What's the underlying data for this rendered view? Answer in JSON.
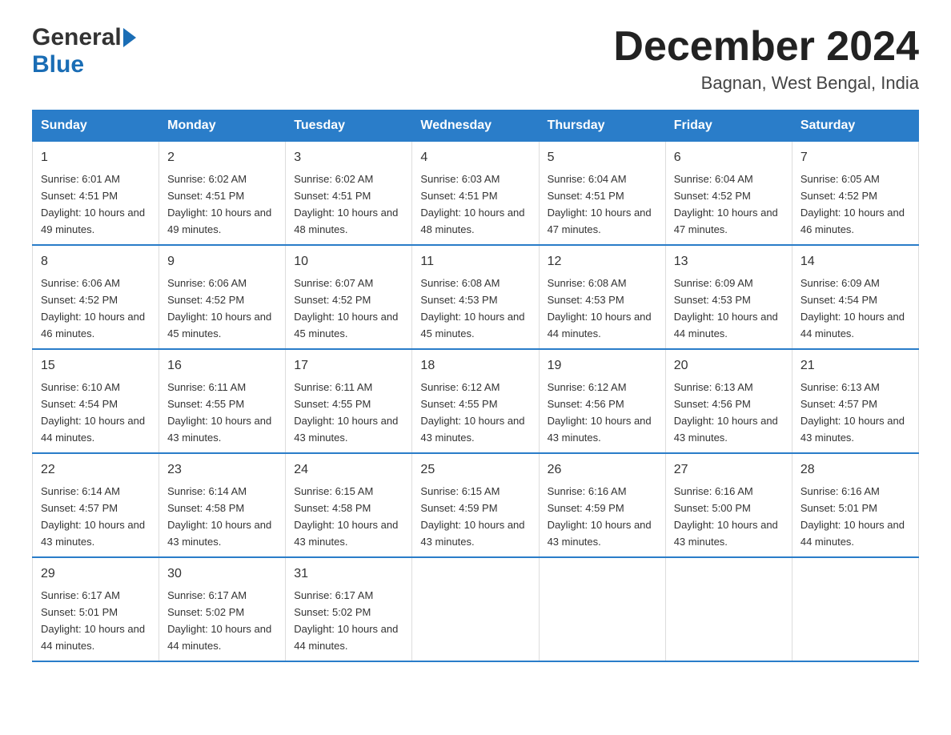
{
  "logo": {
    "general": "General",
    "blue": "Blue"
  },
  "title": "December 2024",
  "subtitle": "Bagnan, West Bengal, India",
  "days": [
    "Sunday",
    "Monday",
    "Tuesday",
    "Wednesday",
    "Thursday",
    "Friday",
    "Saturday"
  ],
  "weeks": [
    [
      {
        "num": "1",
        "sunrise": "6:01 AM",
        "sunset": "4:51 PM",
        "daylight": "10 hours and 49 minutes."
      },
      {
        "num": "2",
        "sunrise": "6:02 AM",
        "sunset": "4:51 PM",
        "daylight": "10 hours and 49 minutes."
      },
      {
        "num": "3",
        "sunrise": "6:02 AM",
        "sunset": "4:51 PM",
        "daylight": "10 hours and 48 minutes."
      },
      {
        "num": "4",
        "sunrise": "6:03 AM",
        "sunset": "4:51 PM",
        "daylight": "10 hours and 48 minutes."
      },
      {
        "num": "5",
        "sunrise": "6:04 AM",
        "sunset": "4:51 PM",
        "daylight": "10 hours and 47 minutes."
      },
      {
        "num": "6",
        "sunrise": "6:04 AM",
        "sunset": "4:52 PM",
        "daylight": "10 hours and 47 minutes."
      },
      {
        "num": "7",
        "sunrise": "6:05 AM",
        "sunset": "4:52 PM",
        "daylight": "10 hours and 46 minutes."
      }
    ],
    [
      {
        "num": "8",
        "sunrise": "6:06 AM",
        "sunset": "4:52 PM",
        "daylight": "10 hours and 46 minutes."
      },
      {
        "num": "9",
        "sunrise": "6:06 AM",
        "sunset": "4:52 PM",
        "daylight": "10 hours and 45 minutes."
      },
      {
        "num": "10",
        "sunrise": "6:07 AM",
        "sunset": "4:52 PM",
        "daylight": "10 hours and 45 minutes."
      },
      {
        "num": "11",
        "sunrise": "6:08 AM",
        "sunset": "4:53 PM",
        "daylight": "10 hours and 45 minutes."
      },
      {
        "num": "12",
        "sunrise": "6:08 AM",
        "sunset": "4:53 PM",
        "daylight": "10 hours and 44 minutes."
      },
      {
        "num": "13",
        "sunrise": "6:09 AM",
        "sunset": "4:53 PM",
        "daylight": "10 hours and 44 minutes."
      },
      {
        "num": "14",
        "sunrise": "6:09 AM",
        "sunset": "4:54 PM",
        "daylight": "10 hours and 44 minutes."
      }
    ],
    [
      {
        "num": "15",
        "sunrise": "6:10 AM",
        "sunset": "4:54 PM",
        "daylight": "10 hours and 44 minutes."
      },
      {
        "num": "16",
        "sunrise": "6:11 AM",
        "sunset": "4:55 PM",
        "daylight": "10 hours and 43 minutes."
      },
      {
        "num": "17",
        "sunrise": "6:11 AM",
        "sunset": "4:55 PM",
        "daylight": "10 hours and 43 minutes."
      },
      {
        "num": "18",
        "sunrise": "6:12 AM",
        "sunset": "4:55 PM",
        "daylight": "10 hours and 43 minutes."
      },
      {
        "num": "19",
        "sunrise": "6:12 AM",
        "sunset": "4:56 PM",
        "daylight": "10 hours and 43 minutes."
      },
      {
        "num": "20",
        "sunrise": "6:13 AM",
        "sunset": "4:56 PM",
        "daylight": "10 hours and 43 minutes."
      },
      {
        "num": "21",
        "sunrise": "6:13 AM",
        "sunset": "4:57 PM",
        "daylight": "10 hours and 43 minutes."
      }
    ],
    [
      {
        "num": "22",
        "sunrise": "6:14 AM",
        "sunset": "4:57 PM",
        "daylight": "10 hours and 43 minutes."
      },
      {
        "num": "23",
        "sunrise": "6:14 AM",
        "sunset": "4:58 PM",
        "daylight": "10 hours and 43 minutes."
      },
      {
        "num": "24",
        "sunrise": "6:15 AM",
        "sunset": "4:58 PM",
        "daylight": "10 hours and 43 minutes."
      },
      {
        "num": "25",
        "sunrise": "6:15 AM",
        "sunset": "4:59 PM",
        "daylight": "10 hours and 43 minutes."
      },
      {
        "num": "26",
        "sunrise": "6:16 AM",
        "sunset": "4:59 PM",
        "daylight": "10 hours and 43 minutes."
      },
      {
        "num": "27",
        "sunrise": "6:16 AM",
        "sunset": "5:00 PM",
        "daylight": "10 hours and 43 minutes."
      },
      {
        "num": "28",
        "sunrise": "6:16 AM",
        "sunset": "5:01 PM",
        "daylight": "10 hours and 44 minutes."
      }
    ],
    [
      {
        "num": "29",
        "sunrise": "6:17 AM",
        "sunset": "5:01 PM",
        "daylight": "10 hours and 44 minutes."
      },
      {
        "num": "30",
        "sunrise": "6:17 AM",
        "sunset": "5:02 PM",
        "daylight": "10 hours and 44 minutes."
      },
      {
        "num": "31",
        "sunrise": "6:17 AM",
        "sunset": "5:02 PM",
        "daylight": "10 hours and 44 minutes."
      },
      null,
      null,
      null,
      null
    ]
  ]
}
